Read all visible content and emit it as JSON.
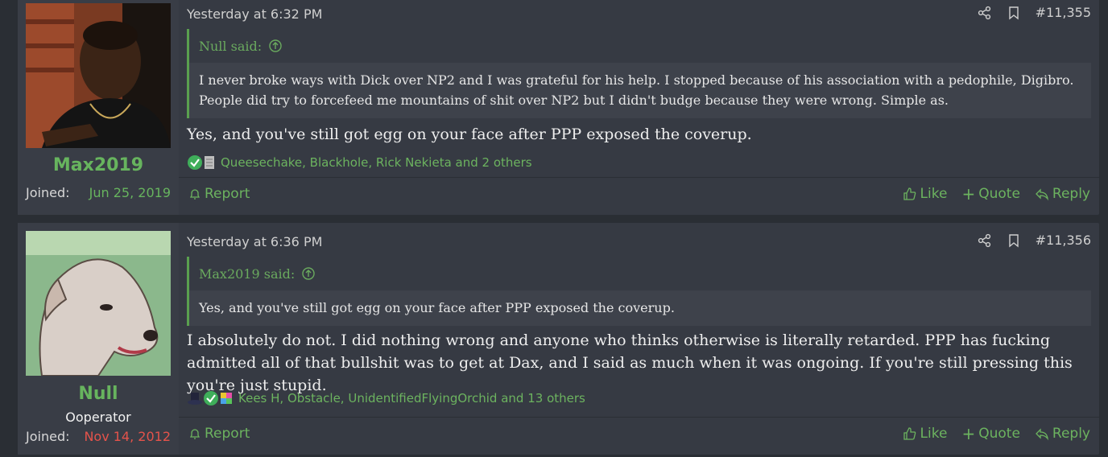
{
  "posts": [
    {
      "username": "Max2019",
      "user_title": "",
      "joined_label": "Joined:",
      "joined_date": "Jun 25, 2019",
      "joined_color": "#67b45e",
      "date": "Yesterday at 6:32 PM",
      "post_number": "#11,355",
      "quote": {
        "author_line": "Null said:",
        "text": "I never broke ways with Dick over NP2 and I was grateful for his help. I stopped because of his association with a pedophile, Digibro. People did try to forcefeed me mountains of shit over NP2 but I didn't budge because they were wrong. Simple as."
      },
      "message": "Yes, and you've still got egg on your face after PPP exposed the coverup.",
      "reactions_text": "Queesechake, Blackhole, Rick Nekieta and 2 others",
      "report_label": "Report",
      "like_label": "Like",
      "quote_label": "Quote",
      "reply_label": "Reply"
    },
    {
      "username": "Null",
      "user_title": "Ooperator",
      "joined_label": "Joined:",
      "joined_date": "Nov 14, 2012",
      "joined_color": "#e5534b",
      "date": "Yesterday at 6:36 PM",
      "post_number": "#11,356",
      "quote": {
        "author_line": "Max2019 said:",
        "text": "Yes, and you've still got egg on your face after PPP exposed the coverup."
      },
      "message": "I absolutely do not. I did nothing wrong and anyone who thinks otherwise is literally retarded. PPP has fucking admitted all of that bullshit was to get at Dax, and I said as much when it was ongoing. If you're still pressing this you're just stupid.",
      "reactions_text": "Kees H, Obstacle, UnidentifiedFlyingOrchid and 13 others",
      "report_label": "Report",
      "like_label": "Like",
      "quote_label": "Quote",
      "reply_label": "Reply"
    }
  ],
  "colors": {
    "accent": "#6cb35f",
    "panel": "#363a43",
    "background": "#2a2e34"
  }
}
